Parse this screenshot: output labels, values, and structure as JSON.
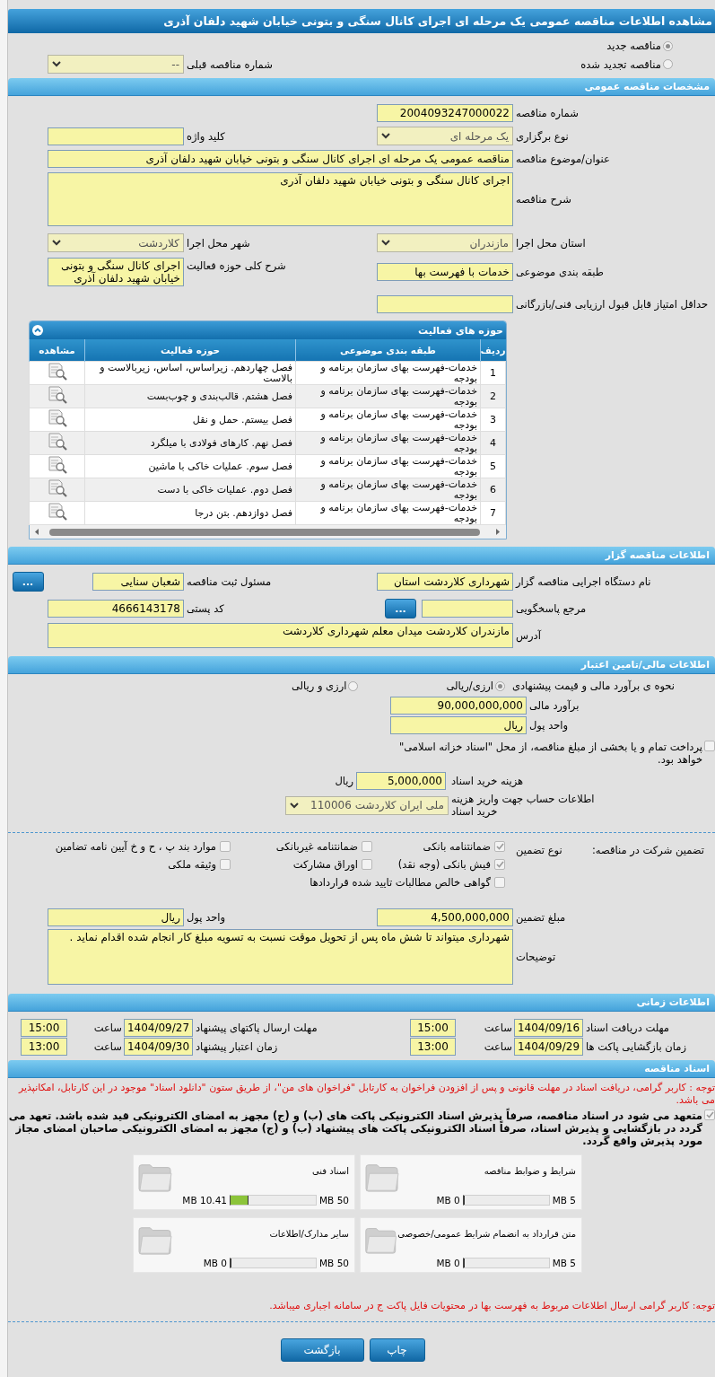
{
  "title": "مشاهده اطلاعات مناقصه عمومی یک مرحله ای اجرای کانال سنگی و بتونی خیابان شهید دلفان آذری",
  "tender_type": [
    {
      "label": "مناقصه جدید",
      "selected": true
    },
    {
      "label": "مناقصه تجدید شده",
      "selected": false
    }
  ],
  "previous_tender": {
    "label": "شماره مناقصه قبلی",
    "value": "--"
  },
  "general": {
    "header": "مشخصات مناقصه عمومی",
    "rows": [
      {
        "kind": "pair",
        "cells": [
          {
            "label": "شماره مناقصه",
            "kind": "input",
            "value": "2004093247000022"
          }
        ]
      },
      {
        "kind": "pair",
        "cells": [
          {
            "label": "نوع برگزاری",
            "kind": "select",
            "value": "یک مرحله ای"
          },
          {
            "label": "کلید واژه",
            "kind": "input"
          }
        ]
      },
      {
        "kind": "wide",
        "cells": [
          {
            "label": "عنوان/موضوع مناقصه",
            "kind": "input",
            "value": "مناقصه عمومی یک مرحله ای اجرای کانال سنگی و بتونی خیابان شهید دلفان آذری"
          }
        ]
      },
      {
        "kind": "wide",
        "cells": [
          {
            "label": "شرح مناقصه",
            "kind": "textarea",
            "value": "اجرای کانال سنگی و بتونی خیابان شهید دلفان آذری"
          }
        ]
      },
      {
        "kind": "pair",
        "cells": [
          {
            "label": "استان محل اجرا",
            "kind": "select",
            "value": "مازندران"
          },
          {
            "label": "شهر محل اجرا",
            "kind": "select",
            "value": "کلاردشت"
          }
        ]
      },
      {
        "kind": "pair",
        "cells": [
          {
            "label": "طبقه بندی موضوعی",
            "kind": "input",
            "value": "خدمات با فهرست بها"
          },
          {
            "label": "شرح کلی حوزه فعالیت",
            "kind": "textarea",
            "value": "اجرای کانال سنگی و بتونی خیابان شهید دلفان آذری"
          }
        ]
      },
      {
        "kind": "pair",
        "cells": [
          {
            "label": "حداقل امتیاز قابل قبول ارزیابی فنی/بازرگانی",
            "kind": "input"
          }
        ]
      }
    ]
  },
  "activities": {
    "title": "حوزه های فعالیت",
    "expanded": true,
    "columns": [
      "ردیف",
      "طبقه بندی موضوعی",
      "حوزه فعالیت",
      "مشاهده"
    ],
    "rows": [
      {
        "index": "1",
        "category": "خدمات-فهرست بهای سازمان برنامه و بودجه",
        "activity": "فصل چهاردهم. زیراساس، اساس، زیربالاست و بالاست"
      },
      {
        "index": "2",
        "category": "خدمات-فهرست بهای سازمان برنامه و بودجه",
        "activity": "فصل هشتم. قالب‌بندی و چوب‌بست"
      },
      {
        "index": "3",
        "category": "خدمات-فهرست بهای سازمان برنامه و بودجه",
        "activity": "فصل بیستم. حمل و نقل"
      },
      {
        "index": "4",
        "category": "خدمات-فهرست بهای سازمان برنامه و بودجه",
        "activity": "فصل نهم. کارهای فولادی با میلگرد"
      },
      {
        "index": "5",
        "category": "خدمات-فهرست بهای سازمان برنامه و بودجه",
        "activity": "فصل سوم. عملیات خاکی با ماشین"
      },
      {
        "index": "6",
        "category": "خدمات-فهرست بهای سازمان برنامه و بودجه",
        "activity": "فصل دوم. عملیات خاکی با دست"
      },
      {
        "index": "7",
        "category": "خدمات-فهرست بهای سازمان برنامه و بودجه",
        "activity": "فصل دوازدهم. بتن درجا"
      }
    ]
  },
  "organizer": {
    "header": "اطلاعات مناقصه گزار",
    "rows": [
      {
        "kind": "pair",
        "cells": [
          {
            "label": "نام دستگاه اجرایی مناقصه گزار",
            "kind": "input",
            "value": "شهرداری کلاردشت استان"
          },
          {
            "label": "مسئول ثبت مناقصه",
            "kind": "input",
            "value": "شعبان سنایی",
            "button": "..."
          }
        ]
      },
      {
        "kind": "pair",
        "cells": [
          {
            "label": "مرجع پاسخگویی",
            "kind": "input",
            "button": "..."
          },
          {
            "label": "کد پستی",
            "kind": "input",
            "value": "4666143178"
          }
        ]
      },
      {
        "kind": "wide",
        "cells": [
          {
            "label": "آدرس",
            "kind": "textarea",
            "value": "مازندران کلاردشت میدان معلم شهرداری کلاردشت"
          }
        ]
      }
    ]
  },
  "finance": {
    "header": "اطلاعات مالی/تامین اعتبار",
    "method": {
      "label": "نحوه ی برآورد مالی و قیمت پیشنهادی",
      "options": [
        {
          "label": "ارزی/ریالی",
          "selected": true
        },
        {
          "label": "ارزی و ریالی",
          "selected": false
        }
      ]
    },
    "fields": [
      {
        "label": "برآورد مالی",
        "value": "90,000,000,000"
      },
      {
        "label": "واحد پول",
        "value": "ریال"
      }
    ],
    "treasury": {
      "checked": false,
      "text": "پرداخت تمام و یا بخشی از مبلغ مناقصه، از محل \"اسناد خزانه اسلامی\" خواهد بود."
    },
    "doc_fee": {
      "label": "هزینه خرید اسناد",
      "value": "5,000,000",
      "unit": "ریال"
    },
    "account": {
      "label": "اطلاعات حساب جهت واریز هزینه خرید اسناد",
      "value": "ملی ایران کلاردشت 110006"
    }
  },
  "guarantee": {
    "title": "تضمین شرکت در مناقصه:",
    "type_label": "نوع تضمین",
    "options": [
      {
        "label": "ضمانتنامه بانکی",
        "checked": true
      },
      {
        "label": "ضمانتنامه غیربانکی",
        "checked": false
      },
      {
        "label": "موارد بند پ ، ح و خ آیین نامه تضامین",
        "checked": false
      },
      {
        "label": "فیش بانکی (وجه نقد)",
        "checked": true
      },
      {
        "label": "اوراق مشارکت",
        "checked": false
      },
      {
        "label": "وثیقه ملکی",
        "checked": false
      },
      {
        "label": "گواهی خالص مطالبات تایید شده قراردادها",
        "checked": false
      }
    ],
    "rows": [
      {
        "kind": "pair",
        "cells": [
          {
            "label": "مبلغ تضمین",
            "kind": "input",
            "value": "4,500,000,000"
          },
          {
            "label": "واحد پول",
            "kind": "input",
            "value": "ریال"
          }
        ]
      },
      {
        "kind": "wide",
        "cells": [
          {
            "label": "توضیحات",
            "kind": "textarea",
            "value": "شهرداری میتواند تا شش ماه پس از تحویل موقت نسبت به تسویه مبلغ کار انجام شده اقدام نماید ."
          }
        ]
      }
    ]
  },
  "timing": {
    "header": "اطلاعات زمانی",
    "rows": [
      {
        "label": "مهلت دریافت اسناد",
        "date": "1404/09/16",
        "time_label": "ساعت",
        "time": "15:00"
      },
      {
        "label": "مهلت ارسال پاکتهای پیشنهاد",
        "date": "1404/09/27",
        "time_label": "ساعت",
        "time": "15:00"
      },
      {
        "label": "زمان بازگشایی پاکت ها",
        "date": "1404/09/29",
        "time_label": "ساعت",
        "time": "13:00"
      },
      {
        "label": "زمان اعتبار پیشنهاد",
        "date": "1404/09/30",
        "time_label": "ساعت",
        "time": "13:00"
      }
    ]
  },
  "documents": {
    "header": "اسناد مناقصه",
    "notice": "توجه : کاربر گرامی، دریافت اسناد در مهلت قانونی و پس از افزودن فراخوان به کارتابل \"فراخوان های من\"، از طریق ستون \"دانلود اسناد\" موجود در این کارتابل، امکانپذیر می باشد.",
    "commitment": {
      "checked": true,
      "text": "متعهد می شود در اسناد مناقصه، صرفاً پذیرش اسناد الکترونیکی پاکت های (ب) و (ج) مجهز به امضای الکترونیکی قید شده باشد. تعهد می گردد در بازگشایی و پذیرش اسناد، صرفاً اسناد الکترونیکی پاکت های پیشنهاد (ب) و (ج) مجهز به امضای الکترونیکی صاحبان امضای مجاز مورد پذیرش واقع گردد."
    },
    "files": [
      {
        "title": "شرایط و ضوابط مناقصه",
        "max": "5 MB",
        "size": "0 MB",
        "level": 0
      },
      {
        "title": "اسناد فنی",
        "max": "50 MB",
        "size": "10.41 MB",
        "level": 0.21
      },
      {
        "title": "متن قرارداد به انضمام شرایط عمومی/خصوصی",
        "max": "5 MB",
        "size": "0 MB",
        "level": 0
      },
      {
        "title": "سایر مدارک/اطلاعات",
        "max": "50 MB",
        "size": "0 MB",
        "level": 0
      }
    ],
    "note": "توجه: کاربر گرامی ارسال اطلاعات مربوط به فهرست بها در محتویات فایل پاکت ج در سامانه اجباری میباشد."
  },
  "buttons": [
    "چاپ",
    "بازگشت"
  ]
}
